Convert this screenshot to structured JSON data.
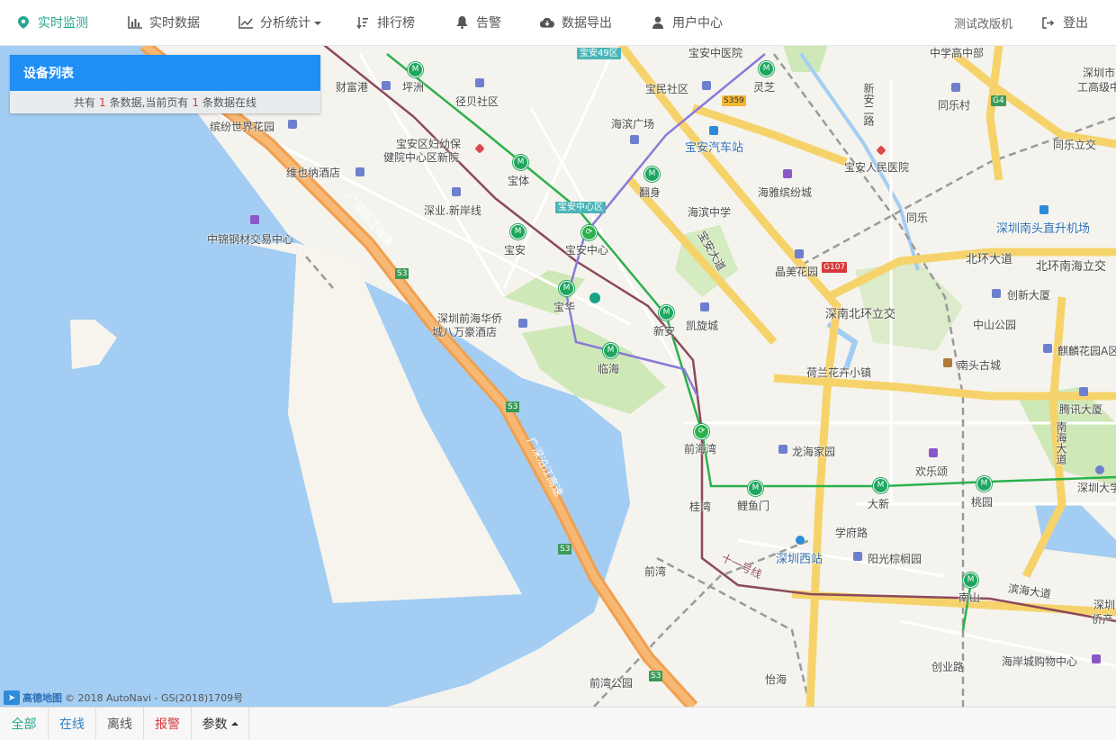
{
  "nav": {
    "items": [
      {
        "label": "实时监测",
        "icon": "location-pin-icon"
      },
      {
        "label": "实时数据",
        "icon": "bar-chart-icon"
      },
      {
        "label": "分析统计",
        "icon": "line-chart-icon"
      },
      {
        "label": "排行榜",
        "icon": "sort-icon"
      },
      {
        "label": "告警",
        "icon": "bell-icon"
      },
      {
        "label": "数据导出",
        "icon": "cloud-download-icon"
      },
      {
        "label": "用户中心",
        "icon": "user-icon"
      }
    ],
    "test_label": "测试改版机",
    "logout_label": "登出",
    "active_color": "#27a68f"
  },
  "device_panel": {
    "title": "设备列表",
    "summary_prefix": "共有",
    "total": "1",
    "summary_mid": "条数据,当前页有",
    "online": "1",
    "summary_suffix": "条数据在线"
  },
  "map": {
    "stations": [
      {
        "name": "坪洲"
      },
      {
        "name": "宝体"
      },
      {
        "name": "宝安"
      },
      {
        "name": "宝安中心"
      },
      {
        "name": "宝华"
      },
      {
        "name": "临海"
      },
      {
        "name": "翻身"
      },
      {
        "name": "新安"
      },
      {
        "name": "灵芝"
      },
      {
        "name": "前海湾"
      },
      {
        "name": "鲤鱼门"
      },
      {
        "name": "大新"
      },
      {
        "name": "桃园"
      },
      {
        "name": "南山"
      }
    ],
    "place_labels": [
      "财富港",
      "径贝社区",
      "缤纷世界花园",
      "宝安区妇幼保",
      "健院中心区新院",
      "维也纳酒店",
      "深业.新岸线",
      "中锦钢材交易中心",
      "深圳前海华侨",
      "城八万豪酒店",
      "宝民社区",
      "海滨广场",
      "宝安汽车站",
      "海雅缤纷城",
      "海滨中学",
      "宝安中医院",
      "宝安人民医院",
      "中学高中部",
      "同乐村",
      "同乐立交",
      "同乐",
      "深圳南头直升机场",
      "北环大道",
      "北环南海立交",
      "创新大厦",
      "晶美花园",
      "深南北环立交",
      "中山公园",
      "凯旋城",
      "荷兰花卉小镇",
      "南头古城",
      "麒麟花园A区",
      "腾讯大厦",
      "龙海家园",
      "欢乐颂",
      "深圳大学",
      "学府路",
      "深圳西站",
      "阳光棕榈园",
      "桂湾",
      "前湾",
      "前湾公园",
      "怡海",
      "创业路",
      "海岸城购物中心",
      "深圳市",
      "工高级中",
      "深圳",
      "侨产",
      "新安二路",
      "南海大道",
      "宝安大道",
      "滨海大道",
      "十一号线",
      "前湾公园"
    ],
    "area_signs": [
      "宝安49区",
      "宝安中心区"
    ],
    "road_signs": [
      "S359",
      "G107",
      "G4",
      "S3"
    ],
    "road_names": [
      "广深沿江高速"
    ],
    "attribution_brand": "高德地图",
    "attribution_text": "© 2018 AutoNavi - GS(2018)1709号",
    "marker_color": "#19a384"
  },
  "filter_bar": {
    "tabs": [
      {
        "label": "全部",
        "color": "#27a68f"
      },
      {
        "label": "在线",
        "color": "#2f7fc1"
      },
      {
        "label": "离线",
        "color": "#555555"
      },
      {
        "label": "报警",
        "color": "#d9383a"
      },
      {
        "label": "参数",
        "color": "#333333"
      }
    ]
  }
}
